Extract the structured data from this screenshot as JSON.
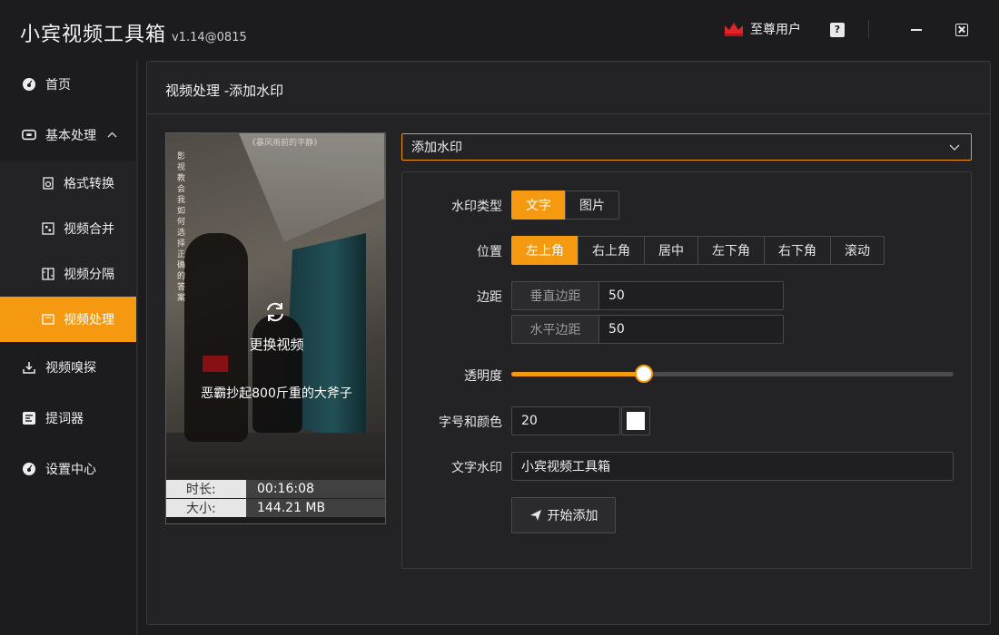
{
  "app": {
    "title": "小宾视频工具箱",
    "version": "v1.14@0815",
    "vip_label": "至尊用户",
    "help_label": "?"
  },
  "colors": {
    "accent": "#f59a10",
    "bg": "#1c1c1e",
    "panel": "#232325",
    "crown": "#e0242a"
  },
  "sidebar": {
    "items": [
      {
        "label": "首页",
        "icon": "home-dashboard-icon"
      },
      {
        "label": "基本处理",
        "icon": "monitor-icon",
        "expanded": true
      },
      {
        "label": "视频嗅探",
        "icon": "download-icon"
      },
      {
        "label": "提词器",
        "icon": "teleprompter-icon"
      },
      {
        "label": "设置中心",
        "icon": "settings-icon"
      }
    ],
    "sub_items": [
      {
        "label": "格式转换",
        "icon": "convert-icon"
      },
      {
        "label": "视频合并",
        "icon": "merge-icon"
      },
      {
        "label": "视频分隔",
        "icon": "split-icon"
      },
      {
        "label": "视频处理",
        "icon": "process-icon",
        "active": true
      }
    ]
  },
  "panel": {
    "title": "视频处理 -添加水印"
  },
  "preview": {
    "replace_label": "更换视频",
    "subtitle": "恶霸抄起800斤重的大斧子",
    "top_caption": "《暴风雨前的平静》",
    "vertical_text": "影视教会我如何选择正确的答案",
    "duration_key": "时长:",
    "duration_value": "00:16:08",
    "size_key": "大小:",
    "size_value": "144.21 MB"
  },
  "dropdown": {
    "selected": "添加水印"
  },
  "form": {
    "watermark_type": {
      "label": "水印类型",
      "options": [
        "文字",
        "图片"
      ],
      "selected": 0
    },
    "position": {
      "label": "位置",
      "options": [
        "左上角",
        "右上角",
        "居中",
        "左下角",
        "右下角",
        "滚动"
      ],
      "selected": 0
    },
    "margin": {
      "label": "边距",
      "vertical_label": "垂直边距",
      "vertical_value": "50",
      "horizontal_label": "水平边距",
      "horizontal_value": "50"
    },
    "opacity": {
      "label": "透明度",
      "value": 0.3
    },
    "font": {
      "label": "字号和颜色",
      "size_value": "20",
      "color": "#ffffff"
    },
    "text": {
      "label": "文字水印",
      "value": "小宾视频工具箱"
    },
    "start_label": "开始添加"
  }
}
